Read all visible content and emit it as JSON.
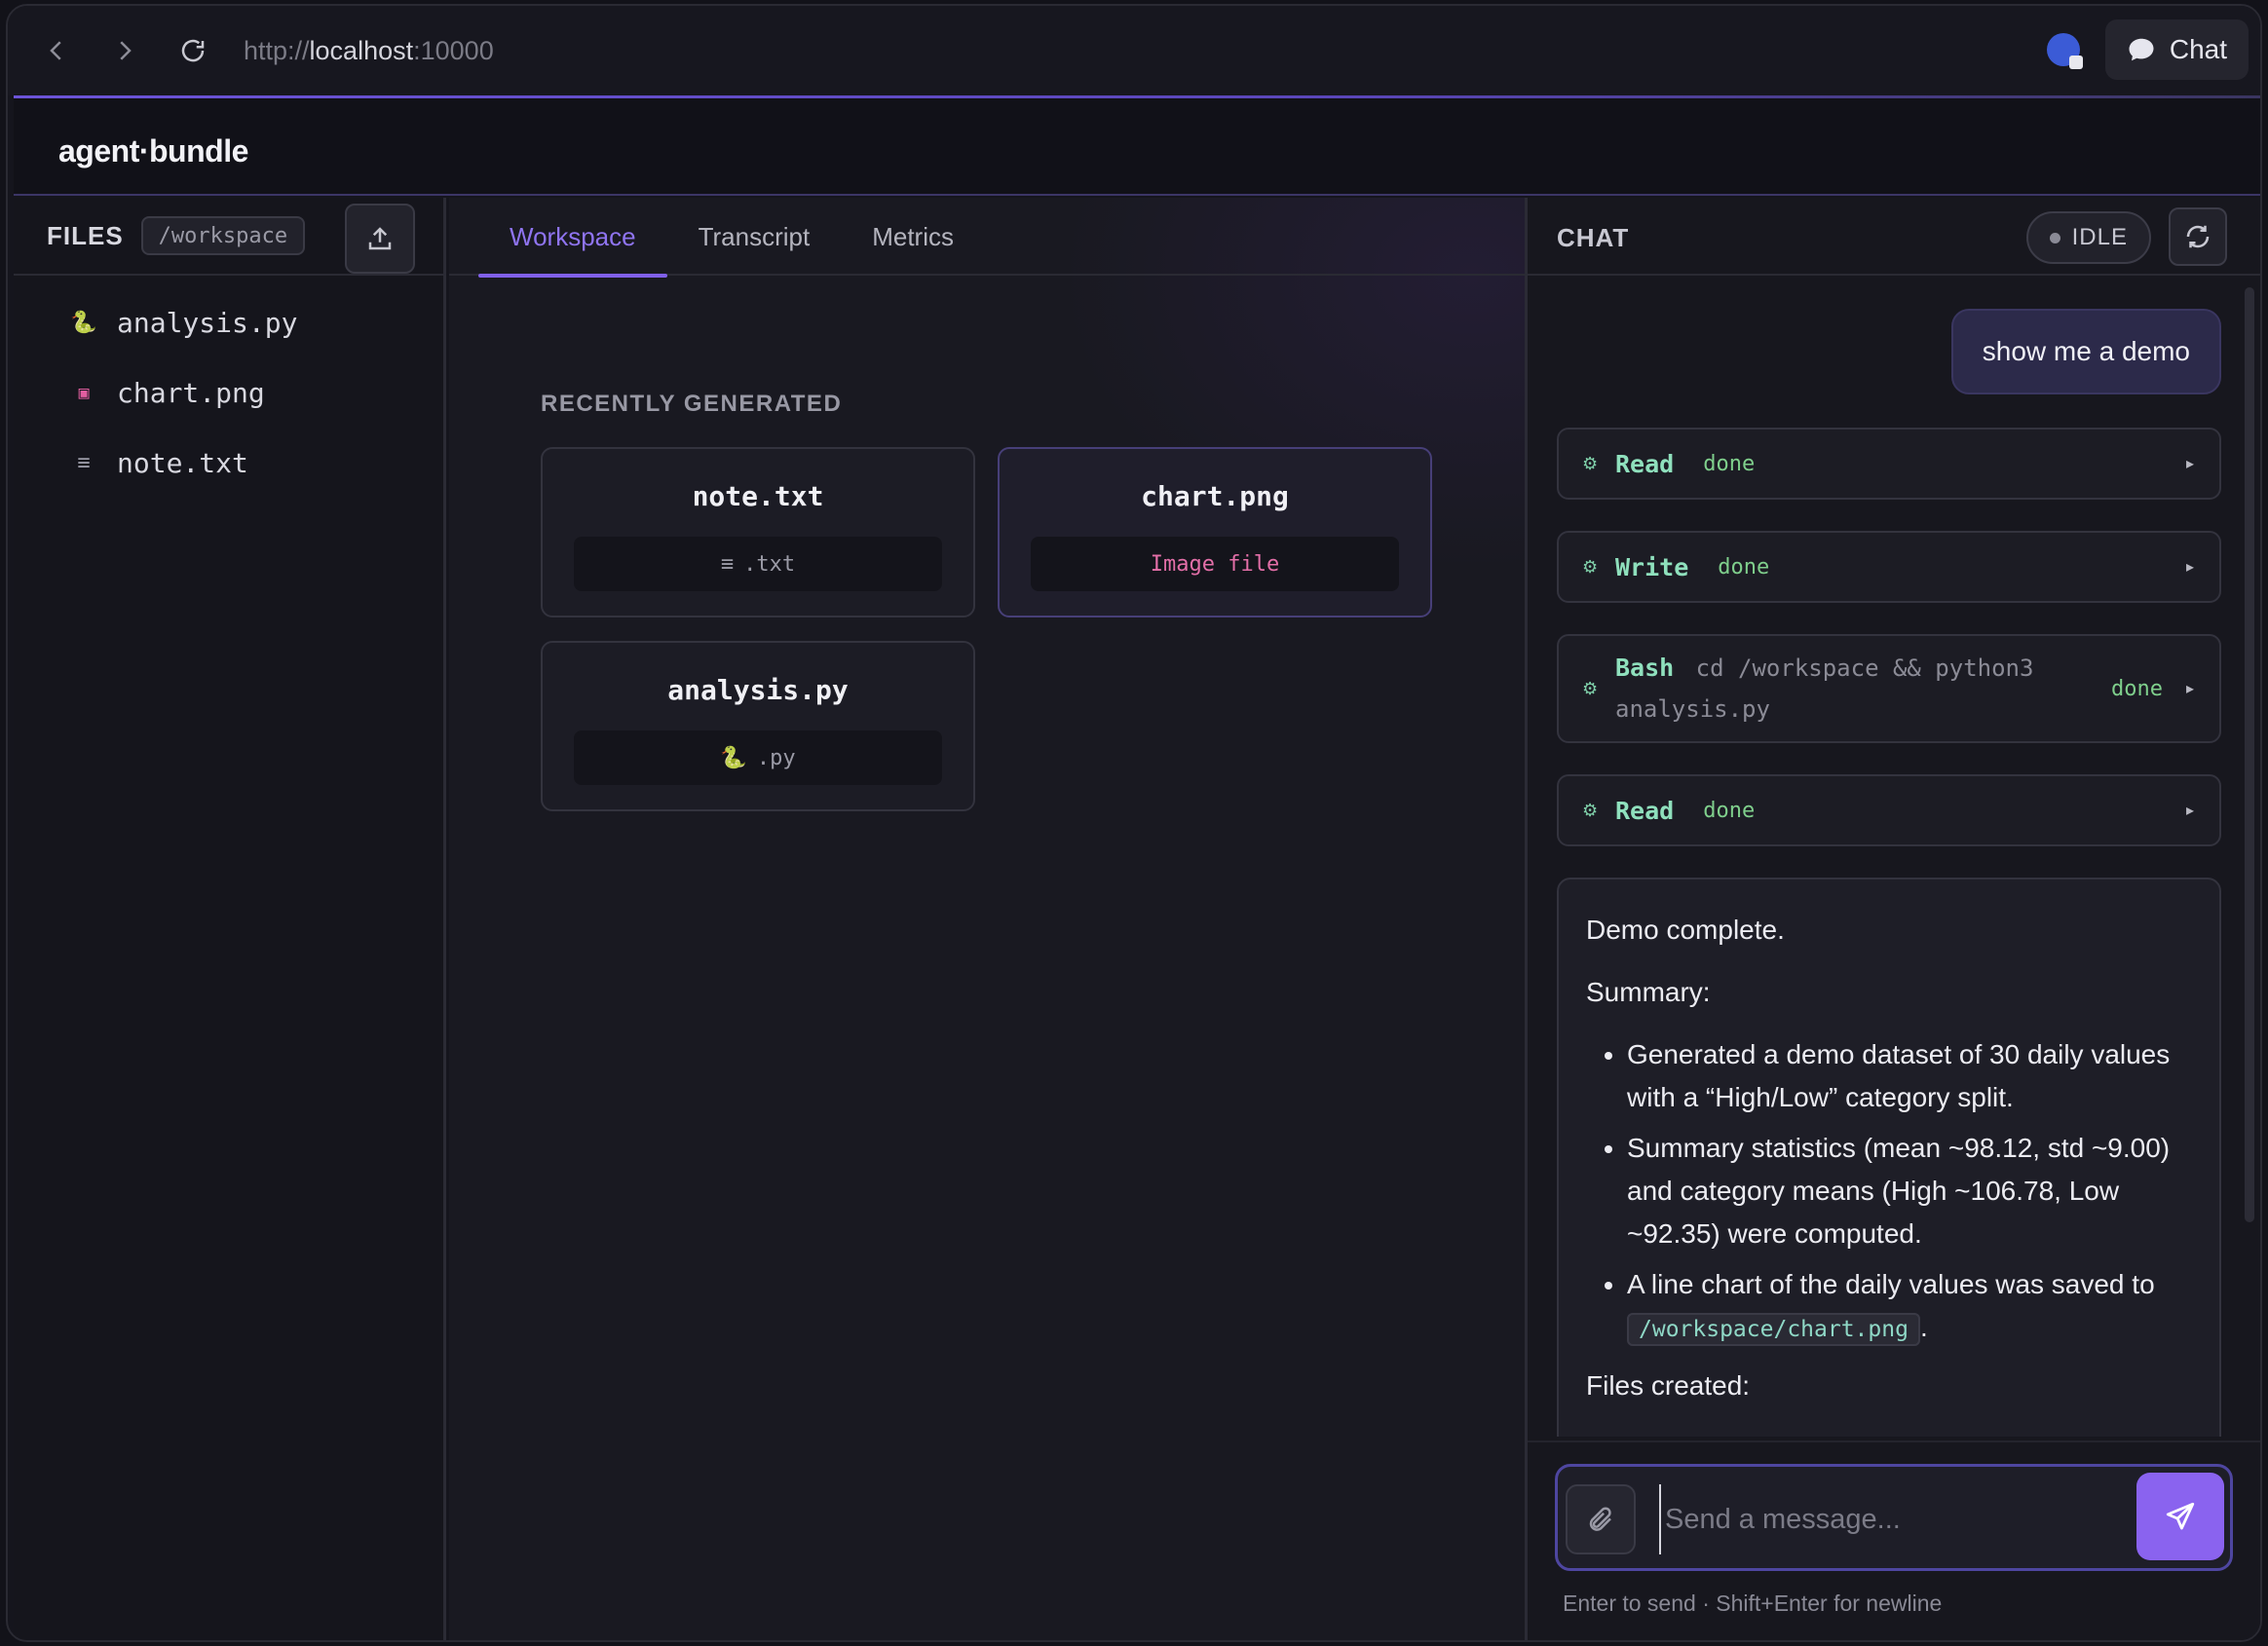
{
  "browser": {
    "url_scheme": "http://",
    "url_host": "localhost",
    "url_port": ":10000",
    "chat_button": "Chat"
  },
  "app": {
    "logo": "agent·bundle"
  },
  "files": {
    "title": "FILES",
    "path": "/workspace",
    "items": [
      {
        "name": "analysis.py",
        "icon": "python-icon"
      },
      {
        "name": "chart.png",
        "icon": "image-icon"
      },
      {
        "name": "note.txt",
        "icon": "text-file-icon"
      }
    ]
  },
  "tabs": [
    "Workspace",
    "Transcript",
    "Metrics"
  ],
  "workspace": {
    "section_label": "RECENTLY GENERATED",
    "cards": [
      {
        "name": "note.txt",
        "type": ".txt",
        "glyph": "≡"
      },
      {
        "name": "chart.png",
        "type": "Image file",
        "glyph": ""
      },
      {
        "name": "analysis.py",
        "type": ".py",
        "glyph": "🐍"
      }
    ]
  },
  "chat": {
    "title": "CHAT",
    "status": "IDLE",
    "user_message": "show me a demo",
    "tools": [
      {
        "name": "Read",
        "status": "done",
        "args": ""
      },
      {
        "name": "Write",
        "status": "done",
        "args": ""
      },
      {
        "name": "Bash",
        "status": "done",
        "args_line1": "cd /workspace && python3",
        "args_line2": "analysis.py"
      },
      {
        "name": "Read",
        "status": "done",
        "args": ""
      }
    ],
    "assistant": {
      "intro": "Demo complete.",
      "summary_label": "Summary:",
      "bullet1": "Generated a demo dataset of 30 daily values with a “High/Low” category split.",
      "bullet2": "Summary statistics (mean ~98.12, std ~9.00) and category means (High ~106.78, Low ~92.35) were computed.",
      "bullet3_pre": "A line chart of the daily values was saved to ",
      "bullet3_code": "/workspace/chart.png",
      "bullet3_post": ".",
      "files_label": "Files created:"
    },
    "input_placeholder": "Send a message...",
    "hint": "Enter to send · Shift+Enter for newline"
  }
}
